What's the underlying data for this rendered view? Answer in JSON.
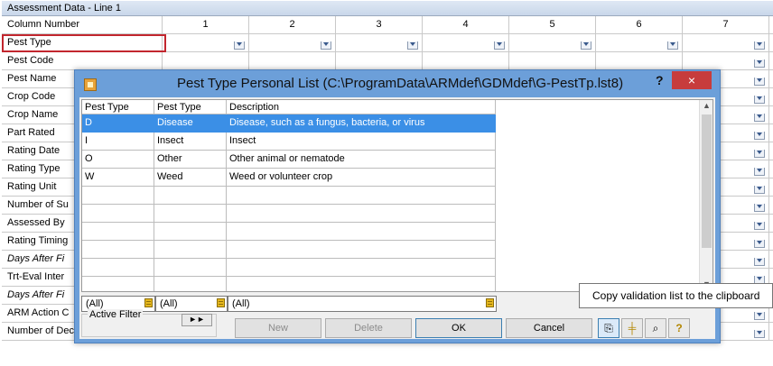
{
  "window": {
    "title": "Assessment Data - Line 1"
  },
  "grid": {
    "column_header_label": "Column Number",
    "columns": [
      "1",
      "2",
      "3",
      "4",
      "5",
      "6",
      "7"
    ],
    "rows": [
      {
        "label": "Pest Type",
        "italic": false
      },
      {
        "label": "Pest Code",
        "italic": false
      },
      {
        "label": "Pest Name",
        "italic": false
      },
      {
        "label": "Crop Code",
        "italic": false
      },
      {
        "label": "Crop Name",
        "italic": false
      },
      {
        "label": "Part Rated",
        "italic": false
      },
      {
        "label": "Rating Date",
        "italic": false
      },
      {
        "label": "Rating Type",
        "italic": false
      },
      {
        "label": "Rating Unit",
        "italic": false
      },
      {
        "label": "Number of Su",
        "italic": false
      },
      {
        "label": "Assessed By",
        "italic": false
      },
      {
        "label": "Rating Timing",
        "italic": false
      },
      {
        "label": "Days After Fi",
        "italic": true
      },
      {
        "label": "Trt-Eval Inter",
        "italic": false
      },
      {
        "label": "Days After Fi",
        "italic": true
      },
      {
        "label": "ARM Action C",
        "italic": false
      },
      {
        "label": "Number of Decimals",
        "italic": false
      }
    ]
  },
  "dialog": {
    "title": "Pest Type Personal List (C:\\ProgramData\\ARMdef\\GDMdef\\G-PestTp.lst8)",
    "help_label": "?",
    "close_label": "×",
    "list_headers": [
      "Pest Type",
      "Pest Type",
      "Description"
    ],
    "list_rows": [
      {
        "code": "D",
        "name": "Disease",
        "desc": "Disease, such as a fungus, bacteria, or virus",
        "selected": true
      },
      {
        "code": "I",
        "name": "Insect",
        "desc": "Insect",
        "selected": false
      },
      {
        "code": "O",
        "name": "Other",
        "desc": "Other animal or nematode",
        "selected": false
      },
      {
        "code": "W",
        "name": "Weed",
        "desc": "Weed or volunteer crop",
        "selected": false
      }
    ],
    "filters": [
      "(All)",
      "(All)",
      "(All)"
    ],
    "active_filter_label": "Active Filter",
    "active_filter_button": "►►",
    "buttons": {
      "new": "New",
      "delete": "Delete",
      "ok": "OK",
      "cancel": "Cancel"
    },
    "tool_icons": [
      "copy-icon",
      "validation-icon",
      "find-icon",
      "help-icon"
    ],
    "tooltip": "Copy validation list to the clipboard"
  }
}
